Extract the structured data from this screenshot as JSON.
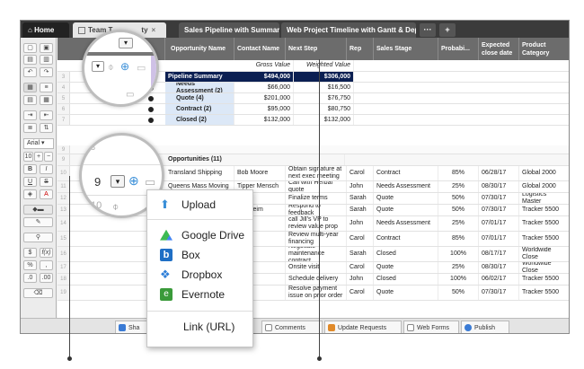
{
  "tabs": {
    "home": "Home",
    "sheet1": "Team T",
    "sheet1_partial": "ty",
    "sheet2": "Sales Pipeline with Summary",
    "sheet3": "Web Project Timeline with Gantt & Dependencies",
    "more": "···",
    "add": "+"
  },
  "toolbar": {
    "font": "Arial",
    "size": "10",
    "plus": "+",
    "minus": "−",
    "bold": "B",
    "italic": "I",
    "underline": "U",
    "strike": "S",
    "currency": "$",
    "percent": "%",
    "fx": "f(x)"
  },
  "columns": [
    "Opportunity Name",
    "Contact Name",
    "Next Step",
    "Rep",
    "Sales Stage",
    "Probabi...",
    "Expected close date",
    "Product Category"
  ],
  "subheader": {
    "gross": "Gross Value",
    "weighted": "Weighted Value"
  },
  "summary": {
    "title": "Pipeline Summary",
    "gross": "$494,000",
    "weighted": "$306,000",
    "items": [
      {
        "label": "Needs Assessment (2)",
        "gross": "$66,000",
        "weighted": "$16,500"
      },
      {
        "label": "Quote (4)",
        "gross": "$201,000",
        "weighted": "$76,750"
      },
      {
        "label": "Contract (2)",
        "gross": "$95,000",
        "weighted": "$80,750"
      },
      {
        "label": "Closed (2)",
        "gross": "$132,000",
        "weighted": "$132,000"
      }
    ]
  },
  "opportunities_label": "Opportunities (11)",
  "rows": [
    {
      "num": "10",
      "name": "Transland Shipping",
      "contact": "Bob Moore",
      "next": "Obtain signature at next exec meeting",
      "rep": "Carol",
      "stage": "Contract",
      "prob": "85%",
      "date": "06/28/17",
      "cat": "Global 2000"
    },
    {
      "num": "11",
      "name": "Queens Mass Moving",
      "contact": "Tipper Mensch",
      "next": "Call with Herbal quote",
      "rep": "John",
      "stage": "Needs Assessment",
      "prob": "25%",
      "date": "08/30/17",
      "cat": "Global 2000"
    },
    {
      "num": "12",
      "name": "",
      "contact": "cole",
      "next": "Finalize terms",
      "rep": "Sarah",
      "stage": "Quote",
      "prob": "50%",
      "date": "07/30/17",
      "cat": "Logistics Master"
    },
    {
      "num": "13",
      "name": "",
      "contact": "Menheim",
      "next": "Respond to feedback",
      "rep": "Sarah",
      "stage": "Quote",
      "prob": "50%",
      "date": "07/30/17",
      "cat": "Tracker 5500"
    },
    {
      "num": "14",
      "name": "",
      "contact": "o",
      "next": "call Jill's VP to review value prop",
      "rep": "John",
      "stage": "Needs Assessment",
      "prob": "25%",
      "date": "07/01/17",
      "cat": "Tracker 5500"
    },
    {
      "num": "15",
      "name": "",
      "contact": "pper",
      "next": "Review multi-year financing",
      "rep": "Carol",
      "stage": "Contract",
      "prob": "85%",
      "date": "07/01/17",
      "cat": "Tracker 5500"
    },
    {
      "num": "16",
      "name": "",
      "contact": "rso",
      "next": "Negotiate maintenance contract",
      "rep": "Sarah",
      "stage": "Closed",
      "prob": "100%",
      "date": "08/17/17",
      "cat": "Worldwide Close"
    },
    {
      "num": "17",
      "name": "",
      "contact": "aano",
      "next": "Onsite visit",
      "rep": "Carol",
      "stage": "Quote",
      "prob": "25%",
      "date": "08/30/17",
      "cat": "Worldwide Close"
    },
    {
      "num": "18",
      "name": "",
      "contact": "pper",
      "next": "Schedule delivery",
      "rep": "John",
      "stage": "Closed",
      "prob": "100%",
      "date": "06/02/17",
      "cat": "Tracker 5500"
    },
    {
      "num": "19",
      "name": "",
      "contact": "wen",
      "next": "Resolve payment issue on prior order",
      "rep": "Carol",
      "stage": "Quote",
      "prob": "50%",
      "date": "07/30/17",
      "cat": "Tracker 5500"
    }
  ],
  "lens": {
    "row_num": "9"
  },
  "attach_menu": {
    "upload": "Upload",
    "gdrive": "Google Drive",
    "box": "Box",
    "dropbox": "Dropbox",
    "evernote": "Evernote",
    "link": "Link (URL)"
  },
  "bottom_tabs": {
    "share": "Sha",
    "comments": "Comments",
    "update": "Update Requests",
    "forms": "Web Forms",
    "publish": "Publish"
  },
  "colors": {
    "summary_dark": "#0b1f52",
    "summary_light": "#dce8f7",
    "upload": "#3a8fd8",
    "box": "#1f6fc5",
    "dropbox": "#2f7fd8",
    "evernote": "#3a9a3a"
  }
}
